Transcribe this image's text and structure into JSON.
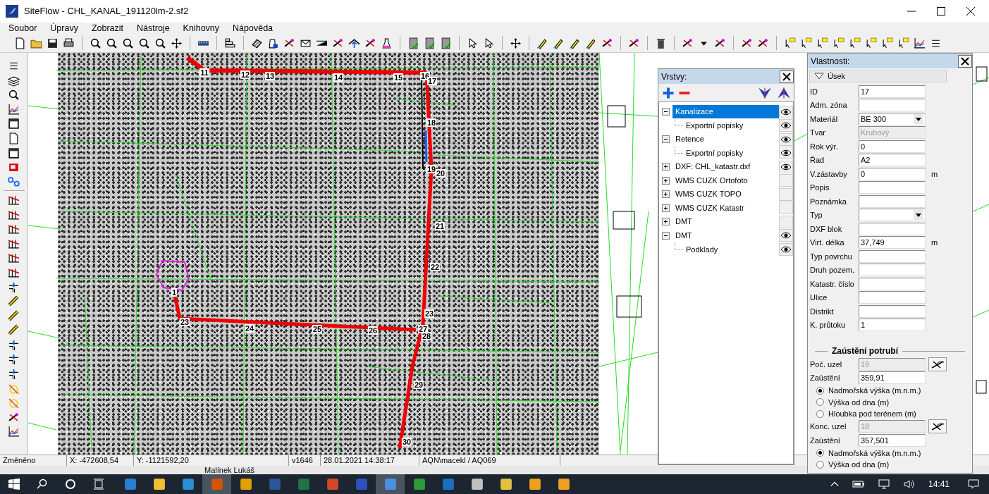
{
  "window": {
    "title": "SiteFlow - CHL_KANAL_191120lm-2.sf2"
  },
  "menu": [
    "Soubor",
    "Úpravy",
    "Zobrazit",
    "Nástroje",
    "Knihovny",
    "Nápověda"
  ],
  "map": {
    "nodes": [
      {
        "label": "11"
      },
      {
        "label": "12"
      },
      {
        "label": "13"
      },
      {
        "label": "14"
      },
      {
        "label": "15"
      },
      {
        "label": "16"
      },
      {
        "label": "17"
      },
      {
        "label": "18"
      },
      {
        "label": "19"
      },
      {
        "label": "20"
      },
      {
        "label": "21"
      },
      {
        "label": "22"
      },
      {
        "label": "23"
      },
      {
        "label": "1"
      },
      {
        "label": "23"
      },
      {
        "label": "24"
      },
      {
        "label": "25"
      },
      {
        "label": "26"
      },
      {
        "label": "27"
      },
      {
        "label": "28"
      },
      {
        "label": "29"
      },
      {
        "label": "30"
      }
    ]
  },
  "layers_panel": {
    "title": "Vrstvy:",
    "layers": [
      {
        "label": "Kanalizace",
        "expanded": true,
        "selected": true,
        "visible": true,
        "children": [
          {
            "label": "Exportní popisky",
            "visible": true
          }
        ]
      },
      {
        "label": "Retence",
        "expanded": true,
        "selected": false,
        "visible": true,
        "children": [
          {
            "label": "Exportní popisky",
            "visible": true
          }
        ]
      },
      {
        "label": "DXF: CHL_katastr.dxf",
        "expanded": false,
        "selected": false,
        "visible": true
      },
      {
        "label": "WMS CUZK Ortofoto",
        "expanded": false,
        "selected": false,
        "visible": false
      },
      {
        "label": "WMS CUZK TOPO",
        "expanded": false,
        "selected": false,
        "visible": false
      },
      {
        "label": "WMS CUZK Katastr",
        "expanded": false,
        "selected": false,
        "visible": false
      },
      {
        "label": "DMT",
        "expanded": false,
        "selected": false,
        "visible": false
      },
      {
        "label": "DMT",
        "expanded": true,
        "selected": false,
        "visible": true,
        "children": [
          {
            "label": "Podklady",
            "visible": true
          }
        ]
      }
    ]
  },
  "properties_panel": {
    "title": "Vlastnosti:",
    "section": {
      "label": "Úsek",
      "expanded": true
    },
    "fields": [
      {
        "kind": "text",
        "label": "ID",
        "value": "17",
        "disabled": false
      },
      {
        "kind": "text",
        "label": "Adm. zóna",
        "disabled": false
      },
      {
        "kind": "select",
        "label": "Materiál",
        "value": "BE 300",
        "disabled": false
      },
      {
        "kind": "text",
        "label": "Tvar",
        "value": "Kruhový",
        "disabled": true
      },
      {
        "kind": "text",
        "label": "Rok výr.",
        "value": "0",
        "disabled": false
      },
      {
        "kind": "text",
        "label": "Řad",
        "value": "A2",
        "disabled": false
      },
      {
        "kind": "text",
        "label": "V.zástavby",
        "value": "0",
        "unit": "m",
        "disabled": false
      },
      {
        "kind": "text",
        "label": "Popis",
        "disabled": false
      },
      {
        "kind": "text",
        "label": "Poznámka",
        "disabled": false
      },
      {
        "kind": "select",
        "label": "Typ",
        "disabled": false
      },
      {
        "kind": "text",
        "label": "DXF blok",
        "disabled": false
      },
      {
        "kind": "text",
        "label": "Virt. délka",
        "value": "37,749",
        "unit": "m",
        "disabled": false
      },
      {
        "kind": "text",
        "label": "Typ povrchu",
        "disabled": false
      },
      {
        "kind": "text",
        "label": "Druh pozem.",
        "disabled": false
      },
      {
        "kind": "text",
        "label": "Katastr. číslo",
        "disabled": false
      },
      {
        "kind": "text",
        "label": "Ulice",
        "disabled": false
      },
      {
        "kind": "text",
        "label": "Distrikt",
        "disabled": false
      },
      {
        "kind": "text",
        "label": "K. průtoku",
        "value": "1",
        "disabled": false
      }
    ],
    "connection": {
      "title": "Zaústění potrubí",
      "groups": [
        {
          "node_label": "Poč. uzel",
          "node_value": "19",
          "node_disabled": true,
          "level_label": "Zaústění",
          "level_value": "359,91",
          "options": [
            {
              "label": "Nadmořská výška (m.n.m.)",
              "selected": true
            },
            {
              "label": "Výška od dna (m)",
              "selected": false
            },
            {
              "label": "Hloubka pod terénem (m)",
              "selected": false
            }
          ]
        },
        {
          "node_label": "Konc. uzel",
          "node_value": "18",
          "node_disabled": true,
          "level_label": "Zaústění",
          "level_value": "357,501",
          "options": [
            {
              "label": "Nadmořská výška (m.n.m.)",
              "selected": true
            },
            {
              "label": "Výška od dna (m)",
              "selected": false
            }
          ]
        }
      ]
    }
  },
  "status_bar": [
    "Změněno",
    "X: -472608,54",
    "Y: -1121592,20",
    "v1646",
    "28.01.2021 14:38:17",
    "AQN\\macekl / AQ069"
  ],
  "background_window_text": "Malínek Lukáš",
  "taskbar": {
    "clock": "14:41"
  }
}
